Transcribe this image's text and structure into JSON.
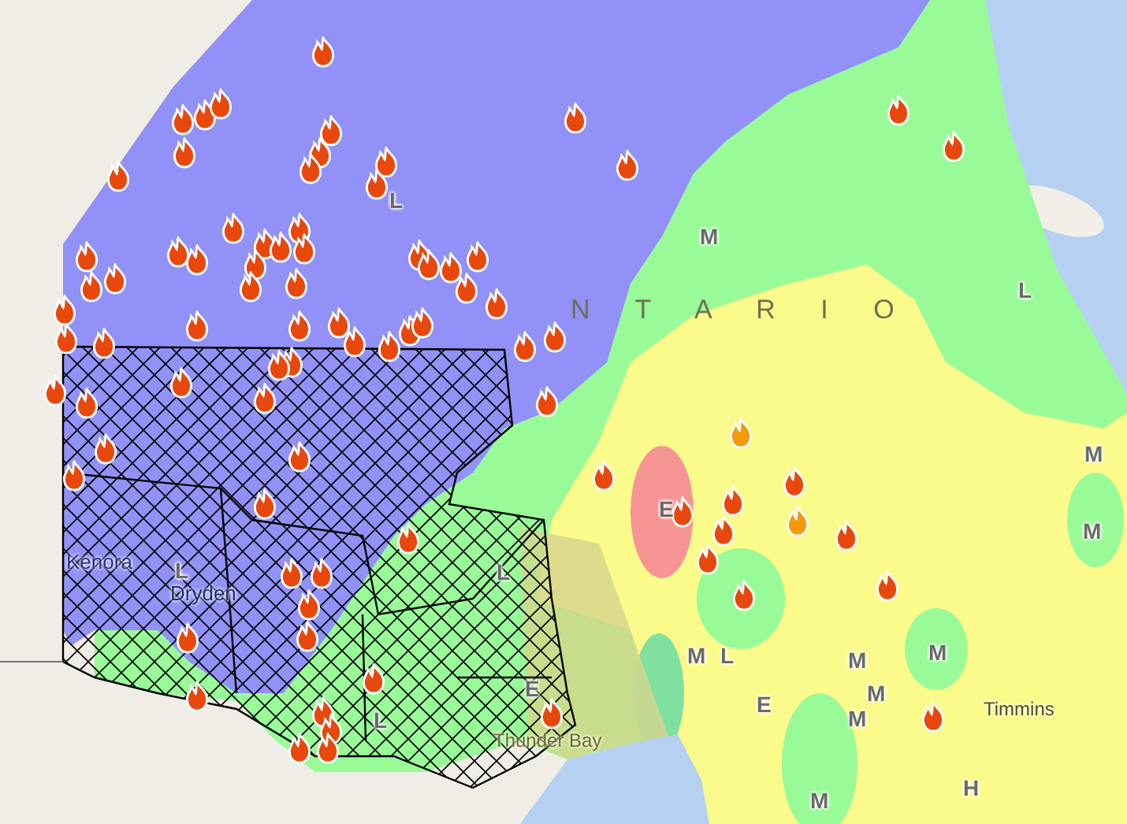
{
  "map": {
    "region_label": "N T A R I O",
    "places": [
      {
        "name": "Kenora"
      },
      {
        "name": "Dryden"
      },
      {
        "name": "Thunder Bay"
      },
      {
        "name": "Timmins"
      }
    ],
    "markers": [
      {
        "letter": "L"
      },
      {
        "letter": "M"
      },
      {
        "letter": "L"
      },
      {
        "letter": "M"
      },
      {
        "letter": "M"
      },
      {
        "letter": "E"
      },
      {
        "letter": "L"
      },
      {
        "letter": "L"
      },
      {
        "letter": "L"
      },
      {
        "letter": "E"
      },
      {
        "letter": "M"
      },
      {
        "letter": "L"
      },
      {
        "letter": "M"
      },
      {
        "letter": "M"
      },
      {
        "letter": "M"
      },
      {
        "letter": "M"
      },
      {
        "letter": "M"
      },
      {
        "letter": "H"
      },
      {
        "letter": "E"
      }
    ],
    "fires": [
      {
        "color": "#e8480c"
      },
      {
        "color": "#e8480c"
      },
      {
        "color": "#e8480c"
      },
      {
        "color": "#e8480c"
      },
      {
        "color": "#e8480c"
      },
      {
        "color": "#e8480c"
      },
      {
        "color": "#e8480c"
      },
      {
        "color": "#e8480c"
      },
      {
        "color": "#e8480c"
      },
      {
        "color": "#e8480c"
      },
      {
        "color": "#e8480c"
      },
      {
        "color": "#e8480c"
      },
      {
        "color": "#e8480c"
      },
      {
        "color": "#e8480c"
      },
      {
        "color": "#e8480c"
      },
      {
        "color": "#e8480c"
      },
      {
        "color": "#e8480c"
      },
      {
        "color": "#e8480c"
      },
      {
        "color": "#e8480c"
      },
      {
        "color": "#e8480c"
      },
      {
        "color": "#e8480c"
      },
      {
        "color": "#e8480c"
      },
      {
        "color": "#e8480c"
      },
      {
        "color": "#e8480c"
      },
      {
        "color": "#e8480c"
      },
      {
        "color": "#e8480c"
      },
      {
        "color": "#e8480c"
      },
      {
        "color": "#e8480c"
      },
      {
        "color": "#e8480c"
      },
      {
        "color": "#e8480c"
      },
      {
        "color": "#e8480c"
      },
      {
        "color": "#e8480c"
      },
      {
        "color": "#e8480c"
      },
      {
        "color": "#e8480c"
      },
      {
        "color": "#e8480c"
      },
      {
        "color": "#e8480c"
      },
      {
        "color": "#e8480c"
      },
      {
        "color": "#e8480c"
      },
      {
        "color": "#e8480c"
      },
      {
        "color": "#e8480c"
      },
      {
        "color": "#e8480c"
      },
      {
        "color": "#e8480c"
      },
      {
        "color": "#e8480c"
      },
      {
        "color": "#e8480c"
      },
      {
        "color": "#e8480c"
      },
      {
        "color": "#e8480c"
      },
      {
        "color": "#e8480c"
      },
      {
        "color": "#e8480c"
      },
      {
        "color": "#e8480c"
      },
      {
        "color": "#e8480c"
      },
      {
        "color": "#e8480c"
      },
      {
        "color": "#e8480c"
      },
      {
        "color": "#e8480c"
      },
      {
        "color": "#e8480c"
      },
      {
        "color": "#e8480c"
      },
      {
        "color": "#e8480c"
      },
      {
        "color": "#e8480c"
      },
      {
        "color": "#e8480c"
      },
      {
        "color": "#e8480c"
      },
      {
        "color": "#e8480c"
      },
      {
        "color": "#e8480c"
      },
      {
        "color": "#e8480c"
      },
      {
        "color": "#e8480c"
      },
      {
        "color": "#e8480c"
      },
      {
        "color": "#e8480c"
      },
      {
        "color": "#e8480c"
      },
      {
        "color": "#e8480c"
      },
      {
        "color": "#e8480c"
      },
      {
        "color": "#e8480c"
      },
      {
        "color": "#e8480c"
      },
      {
        "color": "#e8480c"
      },
      {
        "color": "#e8480c"
      },
      {
        "color": "#e8480c"
      },
      {
        "color": "#e8480c"
      },
      {
        "color": "#e8480c"
      },
      {
        "color": "#e8480c"
      },
      {
        "color": "#e8480c"
      },
      {
        "color": "#e8480c"
      },
      {
        "color": "#e8480c"
      },
      {
        "color": "#e8480c"
      },
      {
        "color": "#f59a0a"
      },
      {
        "color": "#f59a0a"
      }
    ]
  }
}
